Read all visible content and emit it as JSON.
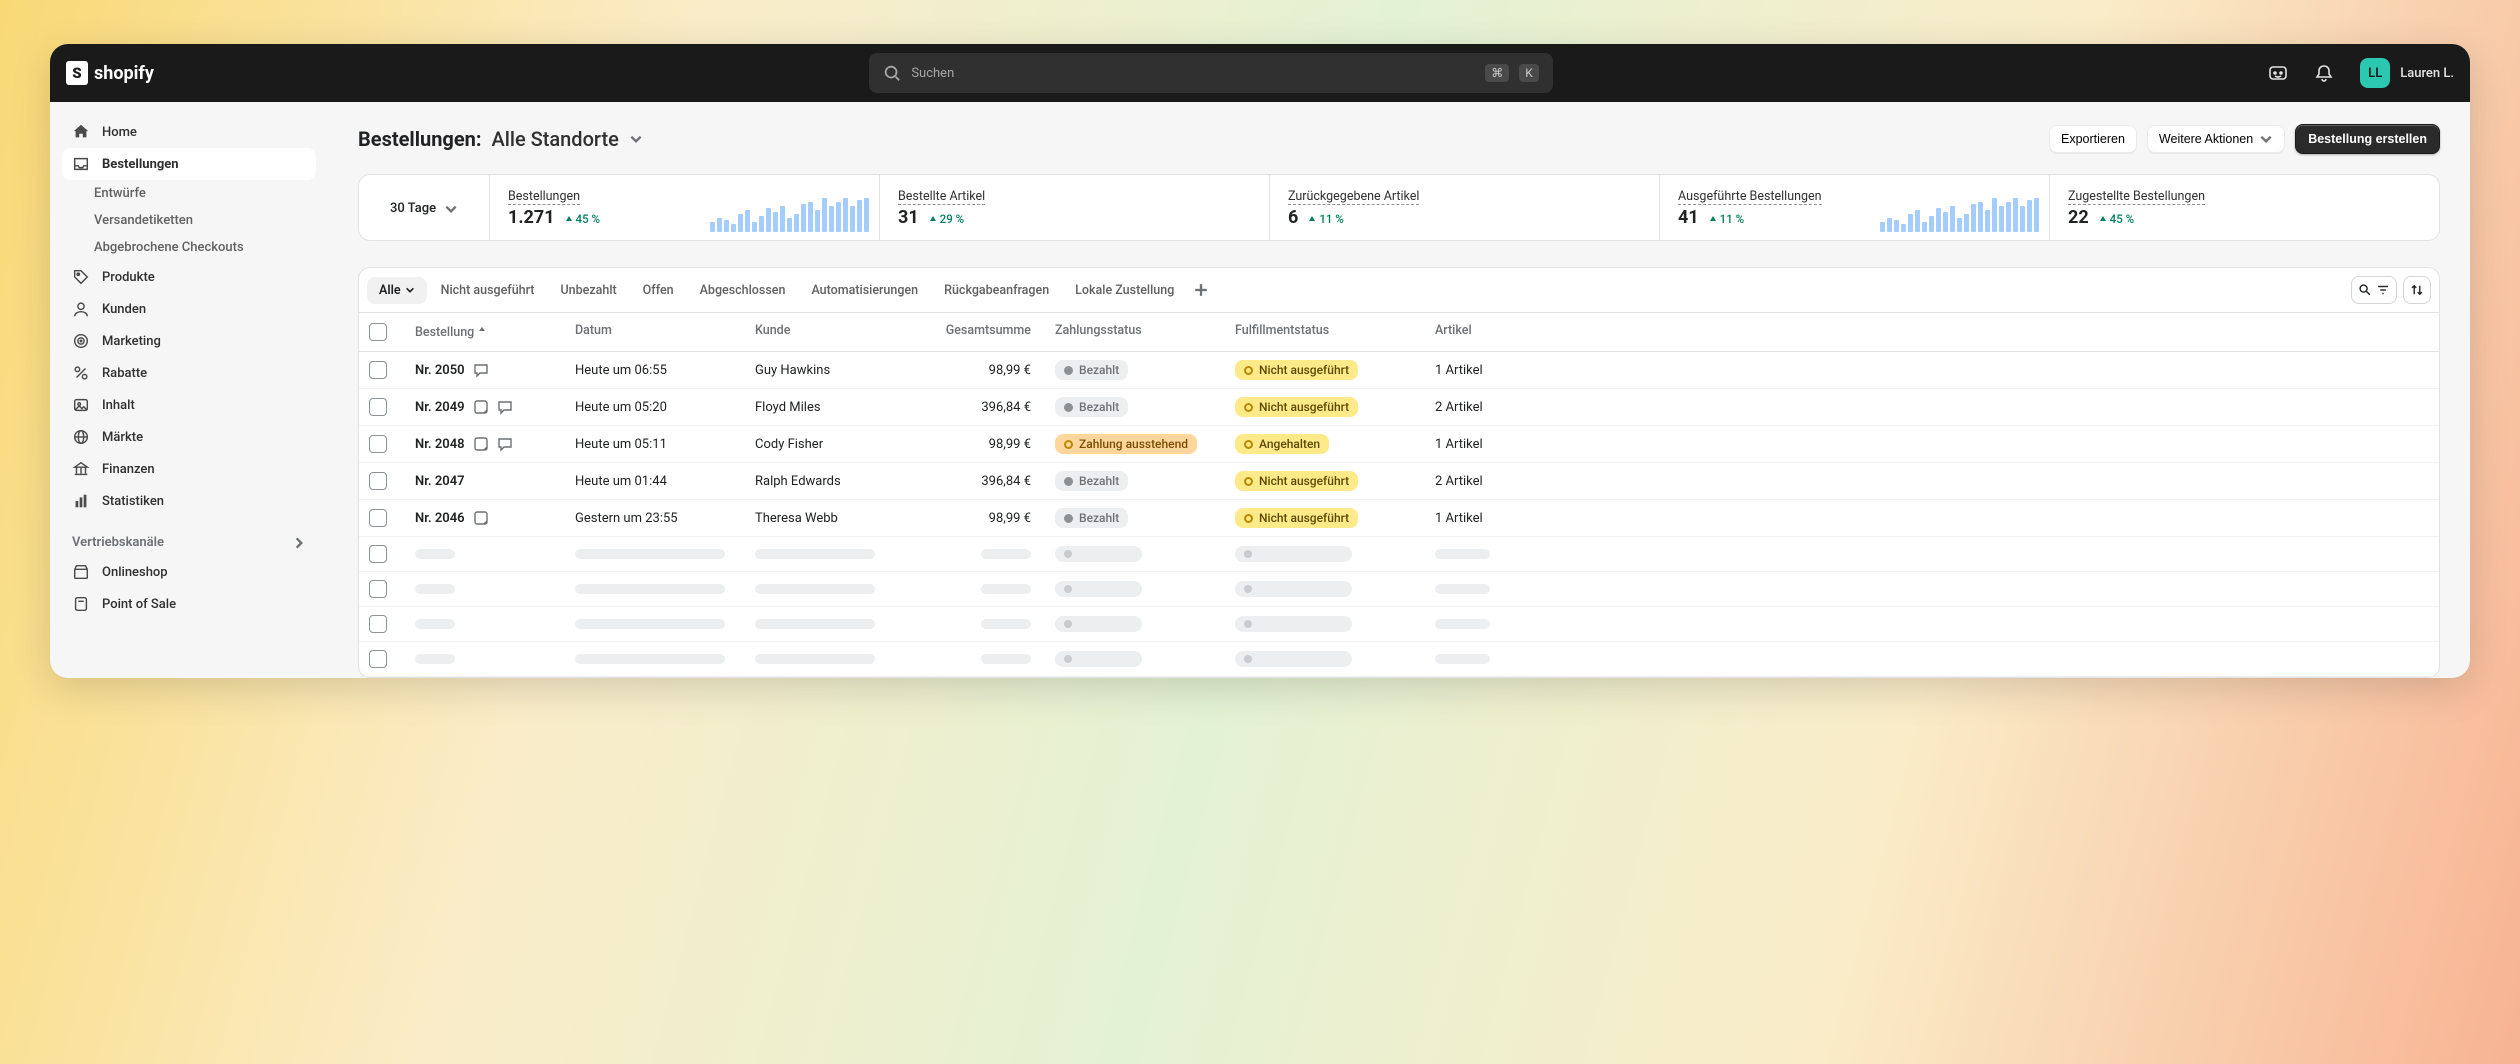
{
  "app_name": "shopify",
  "logo_letter": "S",
  "search": {
    "placeholder": "Suchen",
    "kbd1": "⌘",
    "kbd2": "K"
  },
  "user": {
    "initials": "LL",
    "name": "Lauren L."
  },
  "sidebar": {
    "items": [
      {
        "label": "Home"
      },
      {
        "label": "Bestellungen"
      },
      {
        "label": "Produkte"
      },
      {
        "label": "Kunden"
      },
      {
        "label": "Marketing"
      },
      {
        "label": "Rabatte"
      },
      {
        "label": "Inhalt"
      },
      {
        "label": "Märkte"
      },
      {
        "label": "Finanzen"
      },
      {
        "label": "Statistiken"
      }
    ],
    "subs": [
      {
        "label": "Entwürfe"
      },
      {
        "label": "Versandetiketten"
      },
      {
        "label": "Abgebrochene Checkouts"
      }
    ],
    "section": "Vertriebskanäle",
    "channels": [
      {
        "label": "Onlineshop"
      },
      {
        "label": "Point of Sale"
      }
    ]
  },
  "header": {
    "title": "Bestellungen:",
    "subtitle": "Alle Standorte",
    "export_btn": "Exportieren",
    "more_btn": "Weitere Aktionen",
    "create_btn": "Bestellung erstellen"
  },
  "range_picker": "30 Tage",
  "metrics": [
    {
      "label": "Bestellungen",
      "value": "1.271",
      "delta": "45 %",
      "spark": true
    },
    {
      "label": "Bestellte Artikel",
      "value": "31",
      "delta": "29 %",
      "spark": false
    },
    {
      "label": "Zurückgegebene Artikel",
      "value": "6",
      "delta": "11 %",
      "spark": false
    },
    {
      "label": "Ausgeführte Bestellungen",
      "value": "41",
      "delta": "11 %",
      "spark": true
    },
    {
      "label": "Zugestellte Bestellungen",
      "value": "22",
      "delta": "45 %",
      "spark": false
    }
  ],
  "tabs": [
    "Alle",
    "Nicht ausgeführt",
    "Unbezahlt",
    "Offen",
    "Abgeschlossen",
    "Automatisierungen",
    "Rückgabeanfragen",
    "Lokale Zustellung"
  ],
  "columns": {
    "order": "Bestellung",
    "date": "Datum",
    "customer": "Kunde",
    "total": "Gesamtsumme",
    "payment": "Zahlungsstatus",
    "fulfillment": "Fulfillmentstatus",
    "items": "Artikel"
  },
  "status_labels": {
    "paid": "Bezahlt",
    "pending": "Zahlung ausstehend",
    "unfulfilled": "Nicht ausgeführt",
    "onhold": "Angehalten"
  },
  "rows": [
    {
      "order": "Nr. 2050",
      "has_note": false,
      "has_chat": true,
      "date": "Heute um 06:55",
      "customer": "Guy Hawkins",
      "total": "98,99 €",
      "payment": "paid",
      "fulfillment": "unfulfilled",
      "items": "1 Artikel"
    },
    {
      "order": "Nr. 2049",
      "has_note": true,
      "has_chat": true,
      "date": "Heute um 05:20",
      "customer": "Floyd Miles",
      "total": "396,84 €",
      "payment": "paid",
      "fulfillment": "unfulfilled",
      "items": "2 Artikel"
    },
    {
      "order": "Nr. 2048",
      "has_note": true,
      "has_chat": true,
      "date": "Heute um 05:11",
      "customer": "Cody Fisher",
      "total": "98,99 €",
      "payment": "pending",
      "fulfillment": "onhold",
      "items": "1 Artikel"
    },
    {
      "order": "Nr. 2047",
      "has_note": false,
      "has_chat": false,
      "date": "Heute um 01:44",
      "customer": "Ralph Edwards",
      "total": "396,84 €",
      "payment": "paid",
      "fulfillment": "unfulfilled",
      "items": "2 Artikel"
    },
    {
      "order": "Nr. 2046",
      "has_note": true,
      "has_chat": false,
      "date": "Gestern um 23:55",
      "customer": "Theresa Webb",
      "total": "98,99 €",
      "payment": "paid",
      "fulfillment": "unfulfilled",
      "items": "1 Artikel"
    }
  ],
  "skeleton_rows": 4,
  "colors": {
    "accent_green": "#008060",
    "badge_yellow": "#ffea8a",
    "badge_orange": "#ffd79d",
    "dark": "#1a1a1a"
  }
}
